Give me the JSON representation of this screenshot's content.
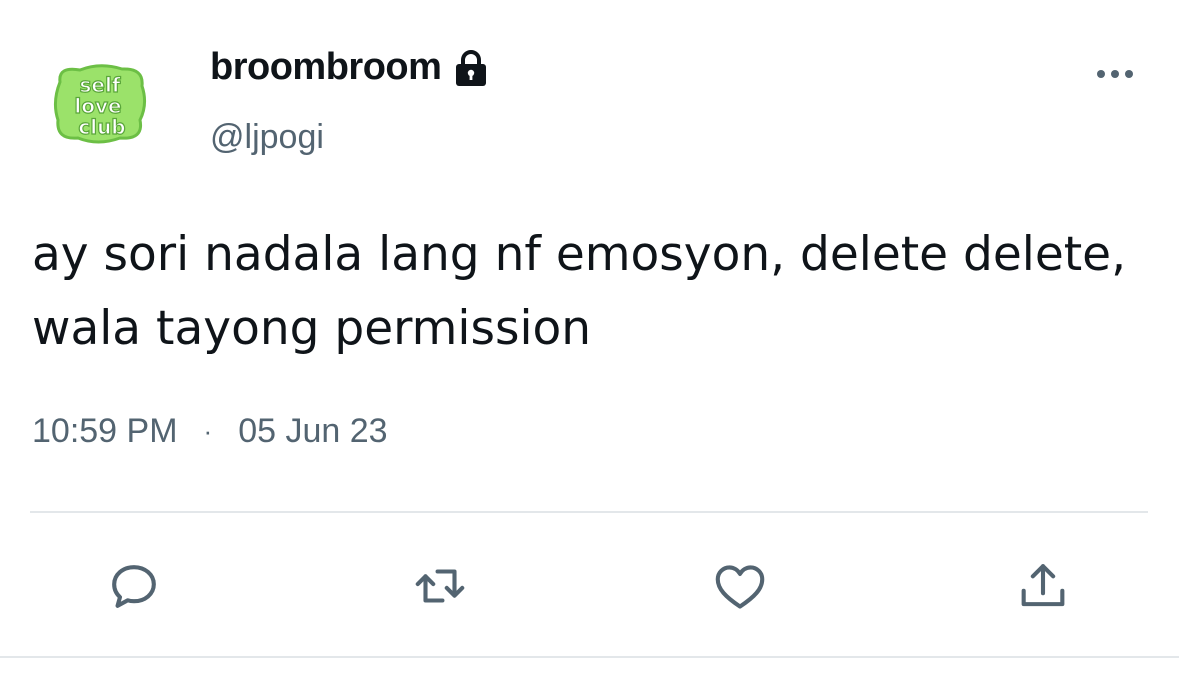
{
  "tweet": {
    "display_name": "broombroom",
    "handle": "@ljpogi",
    "avatar_text": "self love club",
    "text": "ay sori nadala lang nf emosyon, delete delete, wala tayong permission",
    "time": "10:59 PM",
    "separator": "·",
    "date": "05 Jun 23"
  },
  "icons": {
    "lock": "lock-icon",
    "more": "more-icon",
    "reply": "reply-icon",
    "retweet": "retweet-icon",
    "like": "heart-icon",
    "share": "share-icon"
  },
  "colors": {
    "text": "#0f1419",
    "secondary": "#536471",
    "avatar_green": "#9be26a",
    "avatar_dark": "#5aa63a"
  }
}
